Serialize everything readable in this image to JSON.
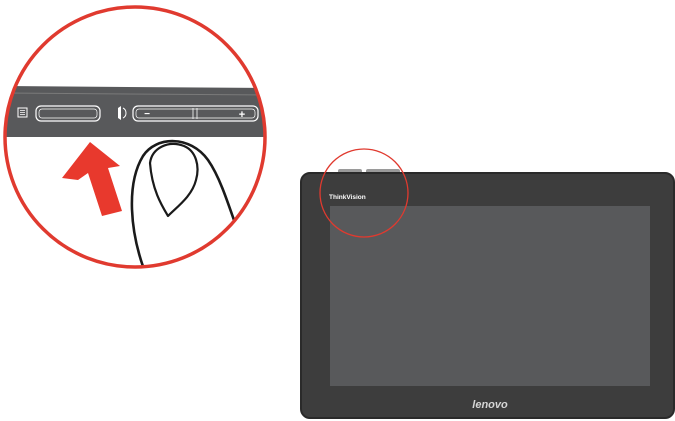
{
  "device": {
    "brand_text": "ThinkVision",
    "logo_text": "lenovo",
    "bezel_color": "#3d3d3d",
    "screen_color": "#58595b",
    "edge_color": "#2a2a2a"
  },
  "zoom_callout": {
    "ring_color": "#e03a2f",
    "panel_color": "#58595b",
    "arrow_color": "#e8392d",
    "minus_label": "−",
    "plus_label": "+"
  }
}
